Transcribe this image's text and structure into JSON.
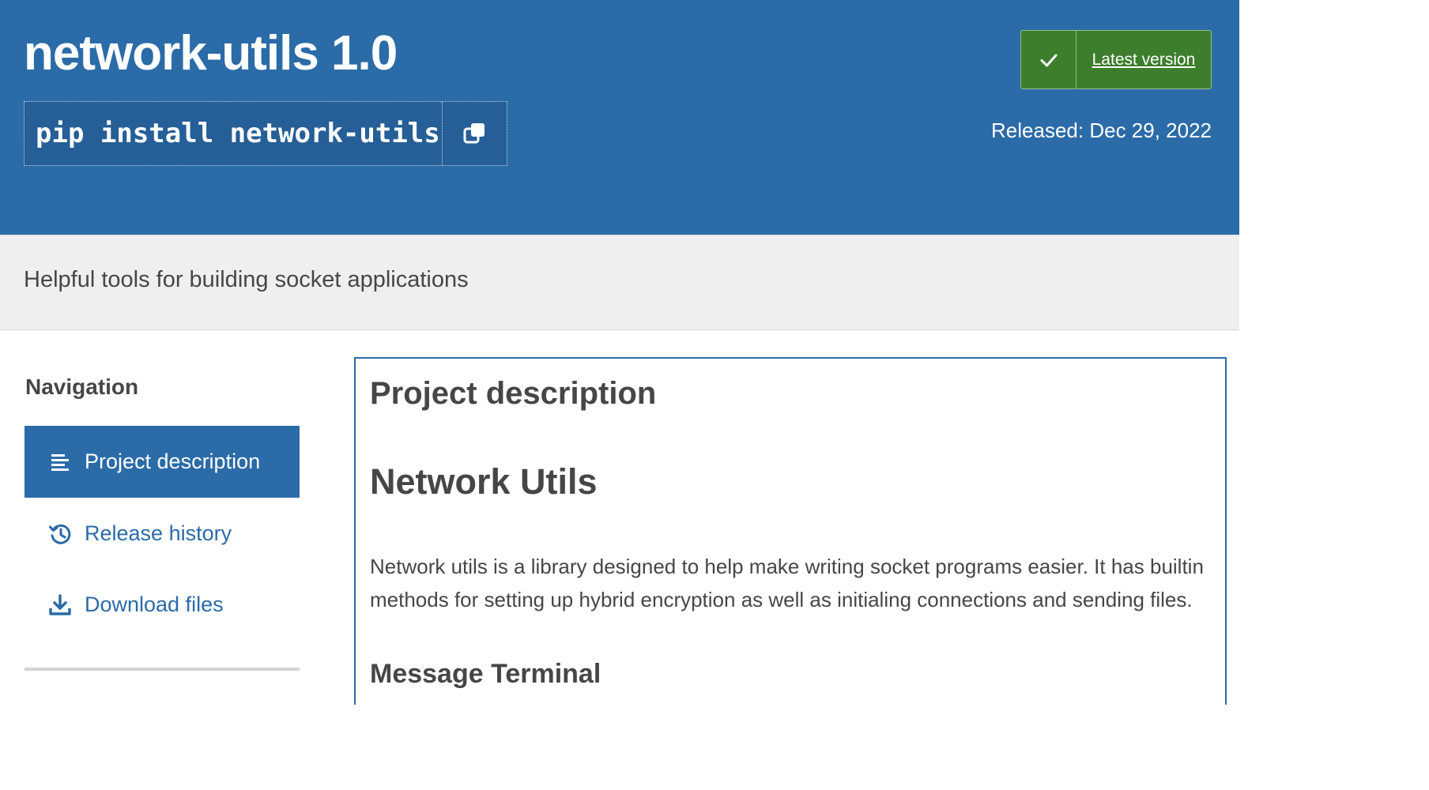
{
  "header": {
    "title": "network-utils 1.0",
    "install_command": "pip install network-utils",
    "copy_icon": "copy-icon",
    "latest_label": "Latest version",
    "latest_icon": "check-icon",
    "released": "Released: Dec 29, 2022"
  },
  "summary": "Helpful tools for building socket applications",
  "navigation": {
    "heading": "Navigation",
    "items": [
      {
        "label": "Project description",
        "icon": "align-left-icon",
        "active": true
      },
      {
        "label": "Release history",
        "icon": "history-icon",
        "active": false
      },
      {
        "label": "Download files",
        "icon": "download-icon",
        "active": false
      }
    ]
  },
  "content": {
    "heading": "Project description",
    "h1": "Network Utils",
    "paragraph": "Network utils is a library designed to help make writing socket programs easier. It has builtin methods for setting up hybrid encryption as well as initialing connections and sending files.",
    "h2": "Message Terminal"
  },
  "colors": {
    "brand_blue": "#2b6ba8",
    "success_green": "#3d7e2d",
    "band_gray": "#efefef",
    "text": "#464646"
  }
}
